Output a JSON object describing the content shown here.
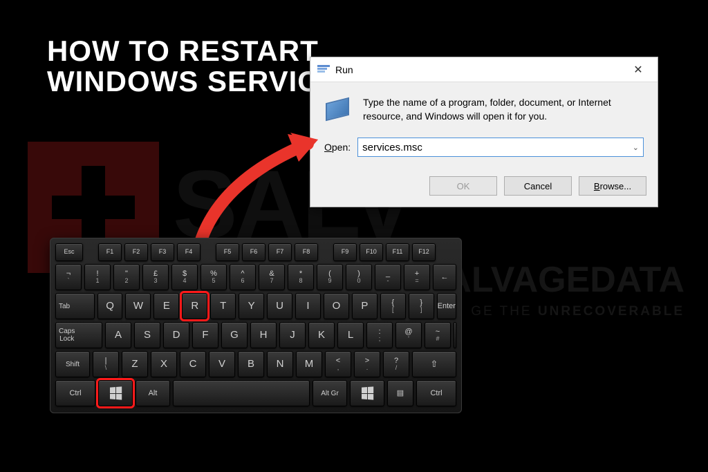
{
  "title_line1": "HOW TO RESTART",
  "title_line2": "WINDOWS SERVICES",
  "watermark": {
    "main1": "SALV",
    "main2": "ALVAGEDATA",
    "tag_prefix": "GE THE ",
    "tag_bold": "UNRECOVERABLE"
  },
  "run_dialog": {
    "title": "Run",
    "description": "Type the name of a program, folder, document, or Internet resource, and Windows will open it for you.",
    "open_label_u": "O",
    "open_label_rest": "pen:",
    "input_value": "services.msc",
    "ok": "OK",
    "cancel": "Cancel",
    "browse_u": "B",
    "browse_rest": "rowse..."
  },
  "keys": {
    "esc": "Esc",
    "frow": [
      "F1",
      "F2",
      "F3",
      "F4",
      "F5",
      "F6",
      "F7",
      "F8",
      "F9",
      "F10",
      "F11",
      "F12"
    ],
    "row1_top": [
      "¬",
      "!",
      "\"",
      "£",
      "$",
      "%",
      "^",
      "&",
      "*",
      "(",
      ")",
      "_",
      "+"
    ],
    "row1_bot": [
      "`",
      "1",
      "2",
      "3",
      "4",
      "5",
      "6",
      "7",
      "8",
      "9",
      "0",
      "-",
      "="
    ],
    "row2": [
      "Q",
      "W",
      "E",
      "R",
      "T",
      "Y",
      "U",
      "I",
      "O",
      "P",
      "{",
      "}"
    ],
    "row2_sub": [
      "",
      "",
      "",
      "",
      "",
      "",
      "",
      "",
      "",
      "",
      "[",
      "]"
    ],
    "row3": [
      "A",
      "S",
      "D",
      "F",
      "G",
      "H",
      "J",
      "K",
      "L",
      ":",
      "@",
      "~"
    ],
    "row3_sub": [
      "",
      "",
      "",
      "",
      "",
      "",
      "",
      "",
      "",
      ";",
      "'",
      "#"
    ],
    "row4": [
      "Z",
      "X",
      "C",
      "V",
      "B",
      "N",
      "M",
      "<",
      ">",
      "?"
    ],
    "row4_sub": [
      "",
      "",
      "",
      "",
      "",
      "",
      "",
      ",",
      ".",
      "/"
    ],
    "tab": "Tab",
    "caps": "Caps\nLock",
    "shiftL": "Shift",
    "shiftR": "Shift",
    "enter": "Enter",
    "ctrl": "Ctrl",
    "alt": "Alt",
    "altgr": "Alt Gr",
    "pipe": "|",
    "pipesub": "\\",
    "backspace": "←",
    "menu": "▤"
  }
}
